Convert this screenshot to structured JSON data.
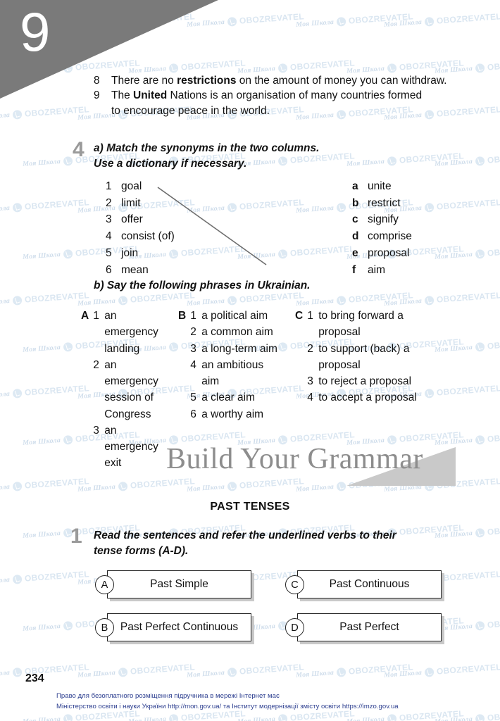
{
  "page": {
    "chapter_number": "9",
    "page_number": "234"
  },
  "sentences": {
    "items": [
      {
        "num": "8",
        "parts": [
          {
            "text": "There are no ",
            "bold": false
          },
          {
            "text": "restrictions",
            "bold": true
          },
          {
            "text": " on the amount of money you can withdraw.",
            "bold": false
          }
        ],
        "continuation": ""
      },
      {
        "num": "9",
        "parts": [
          {
            "text": "The ",
            "bold": false
          },
          {
            "text": "United",
            "bold": true
          },
          {
            "text": " Nations is an organisation of many countries formed",
            "bold": false
          }
        ],
        "continuation": "to encourage peace in the world."
      }
    ]
  },
  "exercise4": {
    "number": "4",
    "instruction_line1": "a) Match the synonyms in the two columns.",
    "instruction_line2": "Use a dictionary if necessary.",
    "left_column": [
      {
        "key": "1",
        "label": "goal"
      },
      {
        "key": "2",
        "label": "limit"
      },
      {
        "key": "3",
        "label": "offer"
      },
      {
        "key": "4",
        "label": "consist (of)"
      },
      {
        "key": "5",
        "label": "join"
      },
      {
        "key": "6",
        "label": "mean"
      }
    ],
    "right_column": [
      {
        "key": "a",
        "label": "unite"
      },
      {
        "key": "b",
        "label": "restrict"
      },
      {
        "key": "c",
        "label": "signify"
      },
      {
        "key": "d",
        "label": "comprise"
      },
      {
        "key": "e",
        "label": "proposal"
      },
      {
        "key": "f",
        "label": "aim"
      }
    ],
    "match_line": {
      "from": "1 goal",
      "to": "f aim"
    },
    "instruction_b": "b) Say the following phrases in Ukrainian.",
    "groups": [
      {
        "letter": "A",
        "items": [
          {
            "num": "1",
            "text": "an emergency landing"
          },
          {
            "num": "2",
            "text": "an emergency session of Congress"
          },
          {
            "num": "3",
            "text": "an emergency exit"
          }
        ]
      },
      {
        "letter": "B",
        "items": [
          {
            "num": "1",
            "text": "a political aim"
          },
          {
            "num": "2",
            "text": "a common aim"
          },
          {
            "num": "3",
            "text": "a long-term aim"
          },
          {
            "num": "4",
            "text": "an ambitious aim"
          },
          {
            "num": "5",
            "text": "a clear aim"
          },
          {
            "num": "6",
            "text": "a worthy aim"
          }
        ]
      },
      {
        "letter": "C",
        "items": [
          {
            "num": "1",
            "text": "to bring forward a proposal"
          },
          {
            "num": "2",
            "text": "to support (back) a proposal"
          },
          {
            "num": "3",
            "text": "to reject a proposal"
          },
          {
            "num": "4",
            "text": "to accept a proposal"
          }
        ]
      }
    ]
  },
  "grammar_section": {
    "title": "Build Your Grammar",
    "subtitle": "PAST TENSES"
  },
  "exercise1": {
    "number": "1",
    "instruction_line1": "Read the sentences and refer the underlined verbs to their",
    "instruction_line2": "tense forms (A-D).",
    "tenses": [
      {
        "letter": "A",
        "label": "Past Simple"
      },
      {
        "letter": "C",
        "label": "Past Continuous"
      },
      {
        "letter": "B",
        "label": "Past Perfect Continuous"
      },
      {
        "letter": "D",
        "label": "Past Perfect"
      }
    ]
  },
  "footer": {
    "line1": "Право для безоплатного розміщення підручника в мережі Інтернет має",
    "line2": "Міністерство освіти і науки України http://mon.gov.ua/ та Інститут модернізації змісту освіти https://imzo.gov.ua"
  },
  "watermark": {
    "school_text": "Моя Школа",
    "brand_text": "OBOZREVATEL"
  },
  "colors": {
    "banner_gray": "#7a7a7a",
    "grammar_triangle": "#c9c9c9",
    "exercise_number": "#9a9a9a",
    "grammar_title": "#8d8d8d",
    "footer_blue": "#2c3e8f",
    "watermark_blue": "#bcd2e6"
  }
}
